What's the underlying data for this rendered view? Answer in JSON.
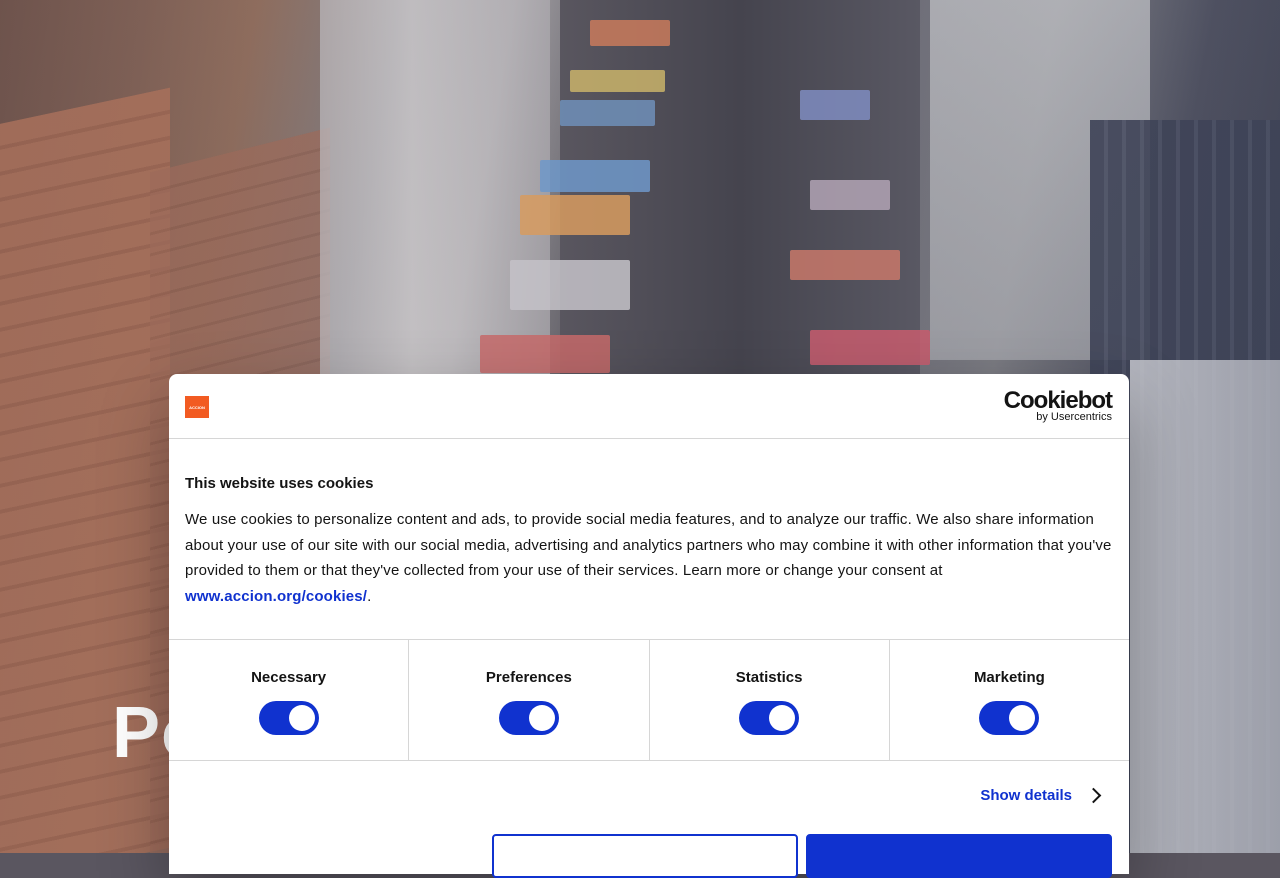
{
  "hero": {
    "title": "Po"
  },
  "dialog": {
    "brand_logo_text": "ACCION",
    "provider_logo": {
      "name": "Cookiebot",
      "subtitle": "by Usercentrics"
    },
    "title": "This website uses cookies",
    "body_text": "We use cookies to personalize content and ads, to provide social media features, and to analyze our traffic. We also share information about your use of our site with our social media, advertising and analytics partners who may combine it with other information that you've provided to them or that they've collected from your use of their services. Learn more or change your consent at ",
    "link_text": "www.accion.org/cookies/",
    "link_suffix": ".",
    "toggles": [
      {
        "label": "Necessary",
        "checked": true
      },
      {
        "label": "Preferences",
        "checked": true
      },
      {
        "label": "Statistics",
        "checked": true
      },
      {
        "label": "Marketing",
        "checked": true
      }
    ],
    "show_details_label": "Show details"
  },
  "colors": {
    "accent": "#1032cf",
    "brand_orange": "#f25b22",
    "text": "#141414",
    "divider": "#d6d6d6"
  }
}
